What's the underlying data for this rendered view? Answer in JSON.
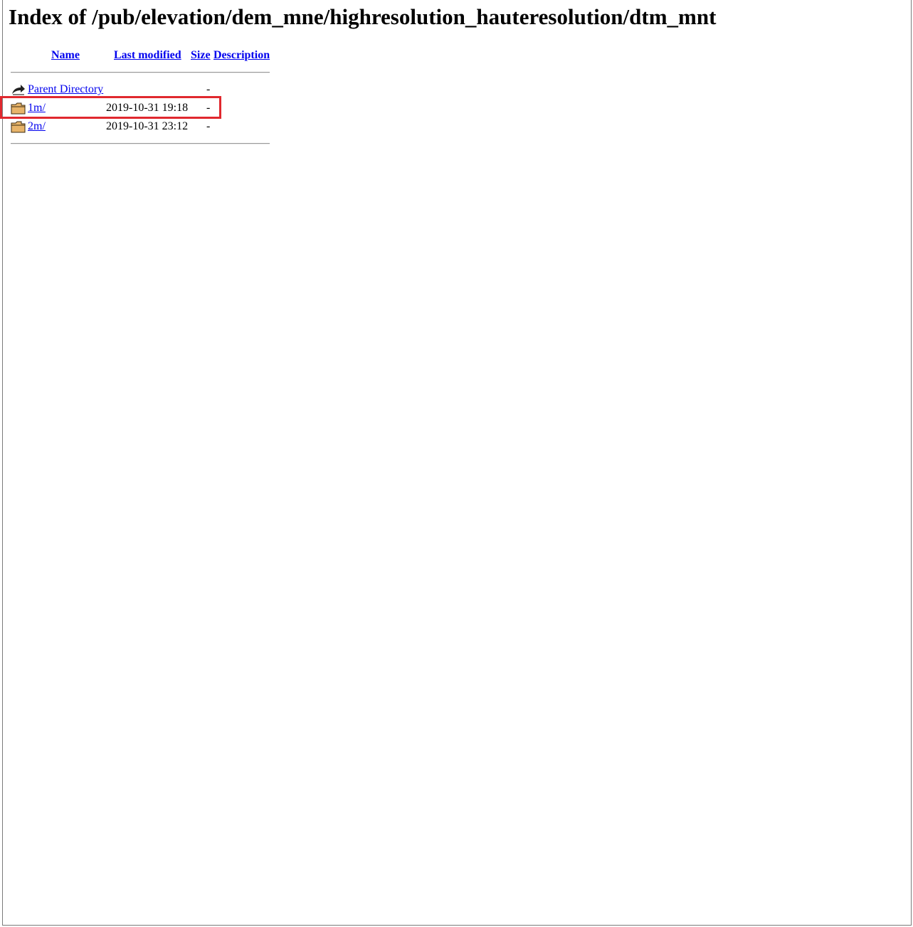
{
  "page": {
    "title": "Index of /pub/elevation/dem_mne/highresolution_hauteresolution/dtm_mnt"
  },
  "columns": {
    "name": "Name",
    "last_modified": "Last modified",
    "size": "Size",
    "description": "Description"
  },
  "entries": [
    {
      "name": "Parent Directory",
      "modified": "",
      "size": "-",
      "icon": "back-arrow-icon"
    },
    {
      "name": "1m/",
      "modified": "2019-10-31 19:18",
      "size": "-",
      "icon": "folder-icon"
    },
    {
      "name": "2m/",
      "modified": "2019-10-31 23:12",
      "size": "-",
      "icon": "folder-icon"
    }
  ],
  "colors": {
    "link": "#0000ee",
    "highlight": "#e0282e",
    "folder": "#e8b46a"
  }
}
